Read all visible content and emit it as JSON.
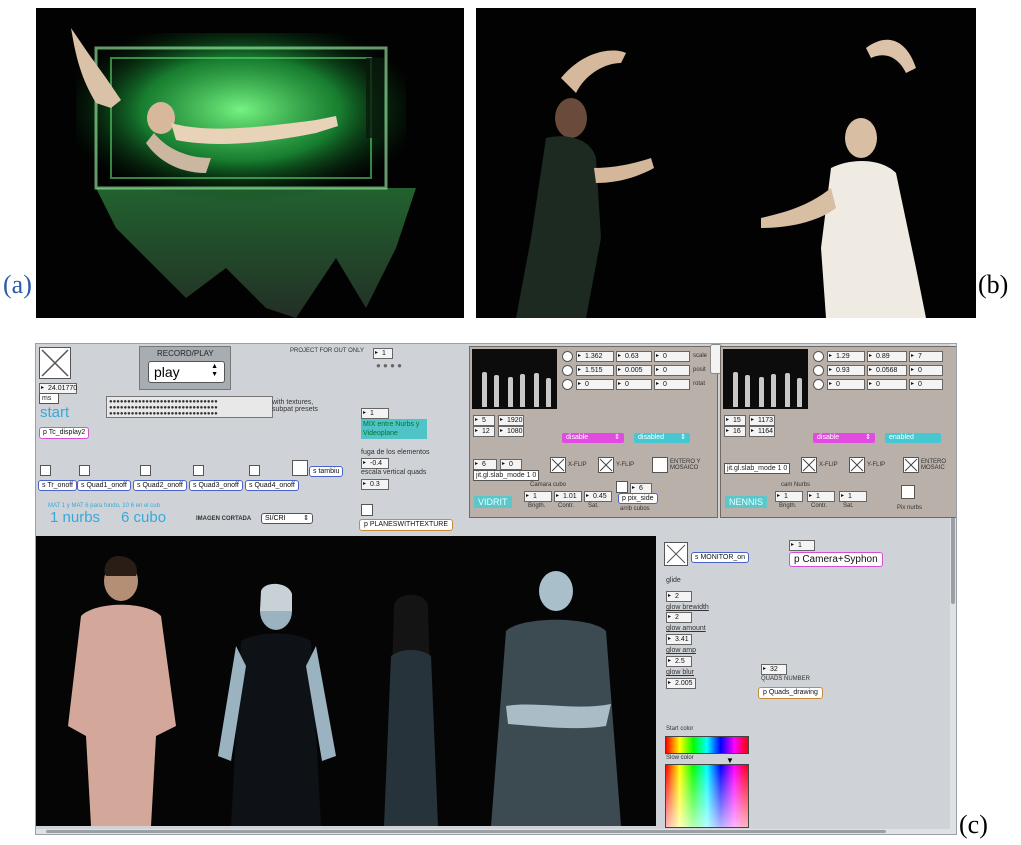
{
  "figure": {
    "labels": {
      "a": "(a)",
      "b": "(b)",
      "c": "(c)"
    }
  },
  "patch": {
    "timer": "24.01770",
    "timer_unit": "ms",
    "start_label": "start",
    "tc_display": "p Tc_display2",
    "record_play": {
      "title": "RECORD/PLAY",
      "mode": "play"
    },
    "project_note": "PROJECT FOR OUT ONLY",
    "project_value": "1",
    "mix_label": "MIX entre Nurbs y Videoplane",
    "mix_value": "1",
    "with_textures": "with textures, subpat presets",
    "fuga_label": "fuga de los elementos",
    "fuga_value": "-0.4",
    "escala_label": "escala vertical quads",
    "escala_value": "0.3",
    "tambiu_button": "s tambiu",
    "quad_buttons": [
      "s Tr_onoff",
      "s Quad1_onoff",
      "s Quad2_onoff",
      "s Quad3_onoff",
      "s Quad4_onoff"
    ],
    "mat_note": "MAT 1 y MAT 6 para fondo, 10 6 en el cub",
    "nurbs_label": "1 nurbs",
    "cubo_label": "6 cubo",
    "imagen_cortada": {
      "label": "IMAGEN CORTADA",
      "value": "SI/CRI"
    },
    "plane_button": "p PLANESWITHTEXTURE",
    "left_panel": {
      "values_col1": [
        "1.362",
        "1.515",
        "0"
      ],
      "values_col2": [
        "0.63",
        "0.005",
        "0"
      ],
      "values_col3": [
        "0",
        "0",
        "0"
      ],
      "row_labels": [
        "scale",
        "posit",
        "rotat"
      ],
      "small_nums": [
        "5",
        "12",
        "1920",
        "1080"
      ],
      "menu_pink": "disable",
      "menu_cyan": "disabled",
      "xflip": "X-FLIP",
      "yflip": "Y-FLIP",
      "entero": "ENTERO Y MOSAICO",
      "mode_box": "jit.gl.slab_mode 1 0",
      "mode_nums": [
        "6",
        "0"
      ],
      "camera_label": "Camara cubo",
      "bcs_values": [
        "1",
        "1.01",
        "0.45"
      ],
      "bcs_labels": [
        "Brigth.",
        "Contr.",
        "Sat."
      ],
      "pixels_value": "6",
      "pixels_box": "p pix_side",
      "arriba_label": "arrib cubos",
      "tag": "VIDRIT"
    },
    "right_panel": {
      "values_col1": [
        "1.29",
        "0.93",
        "0"
      ],
      "values_col2": [
        "0.89",
        "0.0568",
        "0"
      ],
      "values_col3": [
        "7",
        "0",
        "0"
      ],
      "small_nums": [
        "15",
        "16",
        "1173",
        "1164"
      ],
      "menu_pink": "disable",
      "menu_cyan": "enabled",
      "xflip": "X-FLIP",
      "yflip": "Y-FLIP",
      "entero": "ENTERO MOSAIC",
      "mode_box": "jit.gl.slab_mode 1 0",
      "nurbs_label": "cam Nurbs",
      "bcs_values": [
        "1",
        "1",
        "1"
      ],
      "bcs_labels": [
        "Brigth.",
        "Contr.",
        "Sat."
      ],
      "pixels_label": "Pix nurbs",
      "tag": "NENNIS"
    },
    "monitor_box": "s MONITOR_on",
    "camera_value": "1",
    "camera_syphon": "p Camera+Syphon",
    "glide_label": "glide",
    "glide_value": "2",
    "glow_bw_label": "glow brewidth",
    "glow_bw_value": "2",
    "glow_amount_label": "glow amount",
    "glow_amount_value": "3.41",
    "glow_amp_label": "glow amp",
    "glow_amp_value": "2.5",
    "glow_blur_label": "glow blur",
    "glow_blur_value": "2.005",
    "quads_value": "32",
    "quads_label": "QUADS NUMBER",
    "quads_drawing": "p Quads_drawing",
    "start_color": "Start color",
    "slow_color": "Slow color"
  }
}
